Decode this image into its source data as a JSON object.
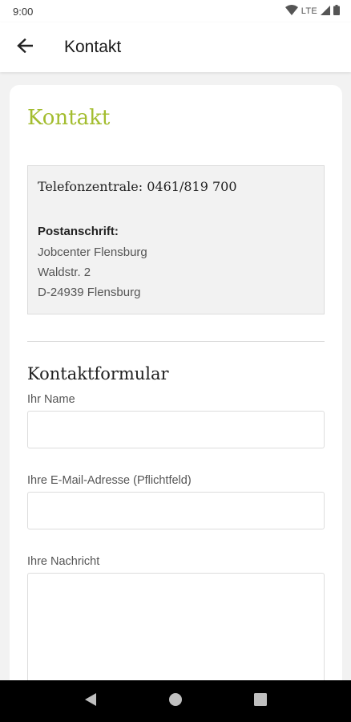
{
  "status_bar": {
    "time": "9:00",
    "network": "LTE"
  },
  "app_bar": {
    "title": "Kontakt"
  },
  "content": {
    "page_title": "Kontakt",
    "phone": "Telefonzentrale: 0461/819 700",
    "address": {
      "heading": "Postanschrift:",
      "lines": [
        "Jobcenter Flensburg",
        "Waldstr. 2",
        "D-24939 Flensburg"
      ]
    },
    "form": {
      "title": "Kontaktformular",
      "name_label": "Ihr Name",
      "name_value": "",
      "email_label": "Ihre E-Mail-Adresse (Pflichtfeld)",
      "email_value": "",
      "message_label": "Ihre Nachricht",
      "message_value": ""
    }
  },
  "colors": {
    "accent": "#a3bd2f",
    "info_box_bg": "#f2f2f2",
    "page_bg": "#f2f2f2"
  },
  "icons": {
    "back": "arrow-left-icon",
    "wifi": "wifi-icon",
    "signal": "signal-icon",
    "battery": "battery-icon",
    "nav_back": "triangle-back-icon",
    "nav_home": "circle-home-icon",
    "nav_recents": "square-recents-icon"
  }
}
